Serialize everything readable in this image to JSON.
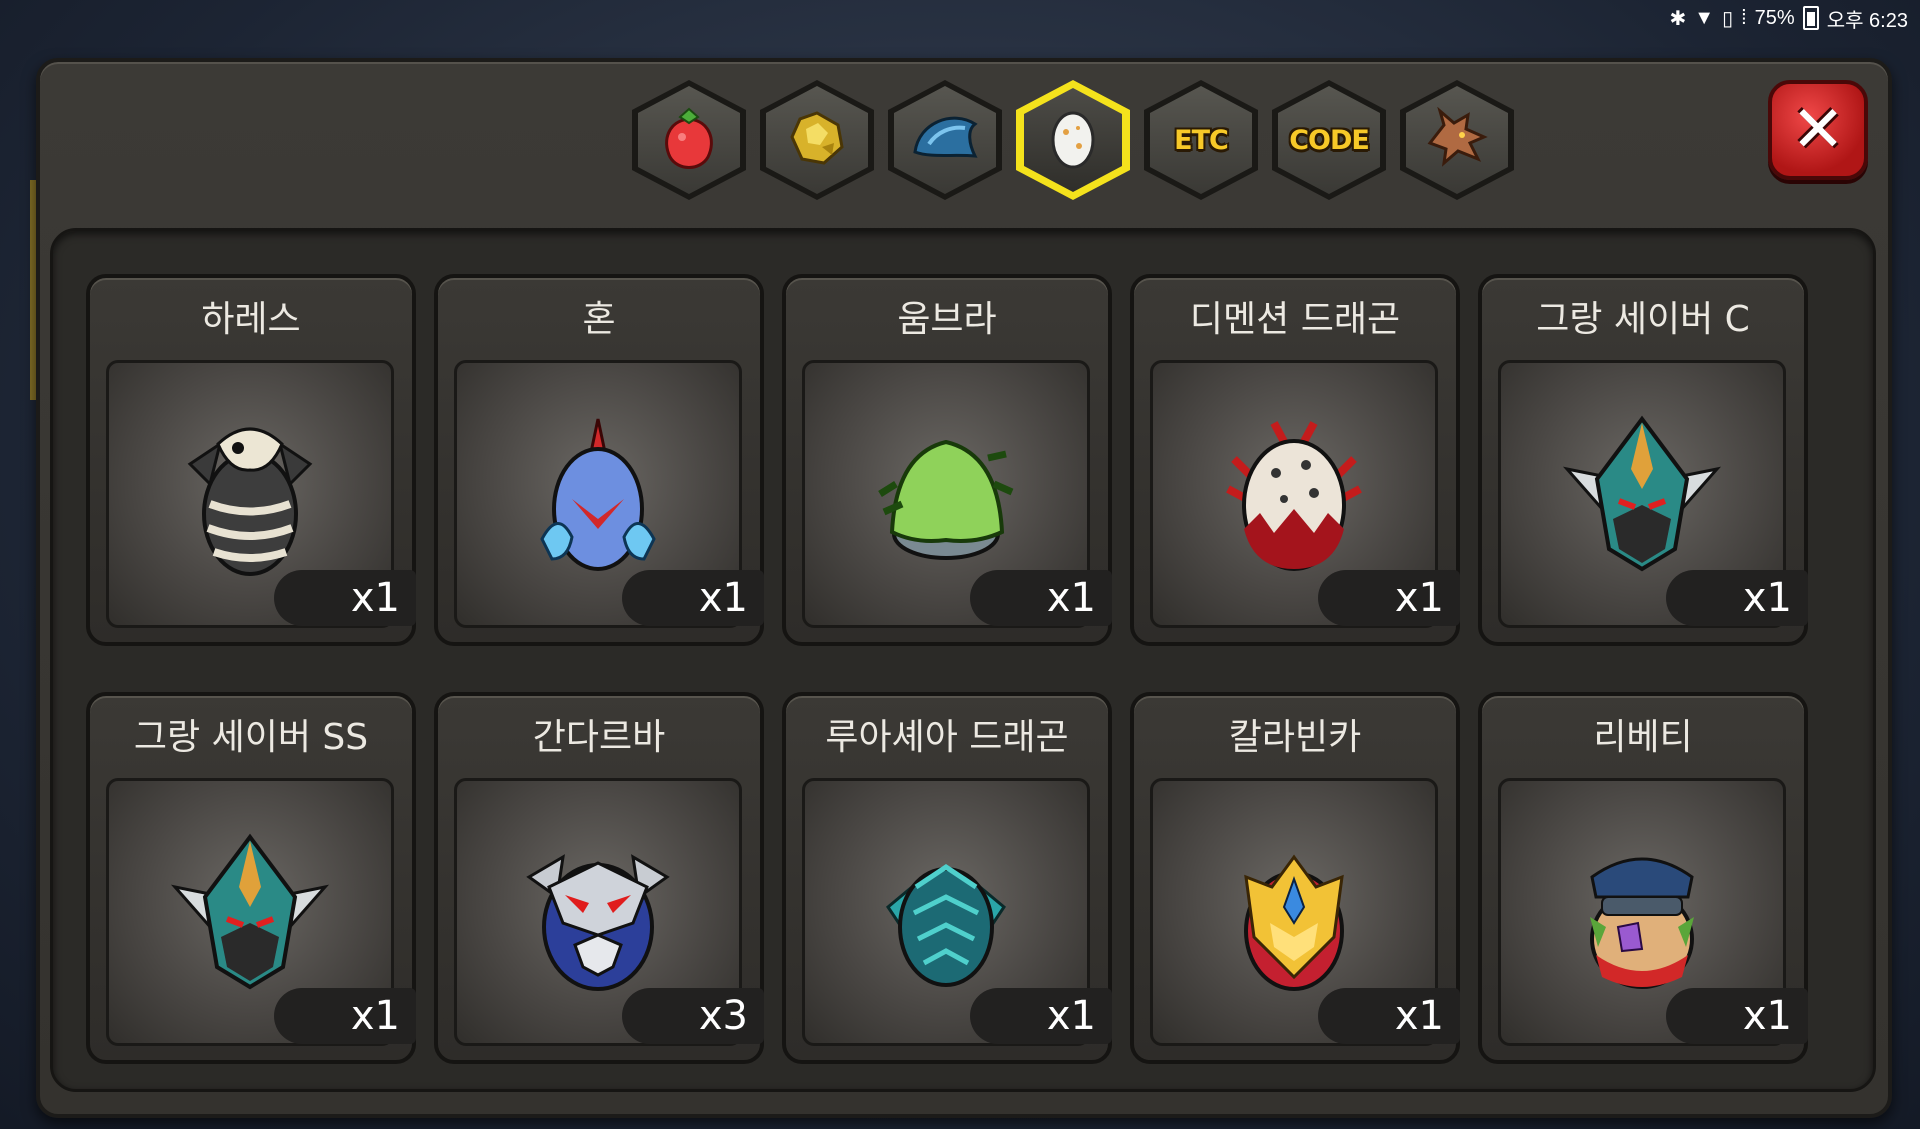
{
  "statusbar": {
    "battery_percent": "75%",
    "time": "오후 6:23"
  },
  "tabs": [
    {
      "id": "fruit",
      "icon": "strawberry-icon",
      "label": "",
      "active": false
    },
    {
      "id": "gold",
      "icon": "gold-ore-icon",
      "label": "",
      "active": false
    },
    {
      "id": "scale",
      "icon": "blue-scale-icon",
      "label": "",
      "active": false
    },
    {
      "id": "egg",
      "icon": "egg-icon",
      "label": "",
      "active": true
    },
    {
      "id": "etc",
      "icon": "",
      "label": "ETC",
      "active": false
    },
    {
      "id": "code",
      "icon": "",
      "label": "CODE",
      "active": false
    },
    {
      "id": "dragon",
      "icon": "dragon-head-icon",
      "label": "",
      "active": false
    }
  ],
  "items": [
    {
      "name": "하레스",
      "qty": "x1",
      "icon": "skeleton-egg-icon"
    },
    {
      "name": "혼",
      "qty": "x1",
      "icon": "blue-flame-egg-icon"
    },
    {
      "name": "움브라",
      "qty": "x1",
      "icon": "green-cloak-egg-icon"
    },
    {
      "name": "디멘션 드래곤",
      "qty": "x1",
      "icon": "spotted-red-egg-icon"
    },
    {
      "name": "그랑 세이버 C",
      "qty": "x1",
      "icon": "green-armor-egg-icon"
    },
    {
      "name": "그랑 세이버 SS",
      "qty": "x1",
      "icon": "green-armor-egg-icon"
    },
    {
      "name": "간다르바",
      "qty": "x3",
      "icon": "silver-mask-egg-icon"
    },
    {
      "name": "루아셰아 드래곤",
      "qty": "x1",
      "icon": "teal-fin-egg-icon"
    },
    {
      "name": "칼라빈카",
      "qty": "x1",
      "icon": "gold-crest-egg-icon"
    },
    {
      "name": "리베티",
      "qty": "x1",
      "icon": "capped-crystal-egg-icon"
    }
  ],
  "colors": {
    "active_tab_border": "#f4e21c",
    "tab_text": "#f7c928",
    "close_button": "#d02020"
  }
}
